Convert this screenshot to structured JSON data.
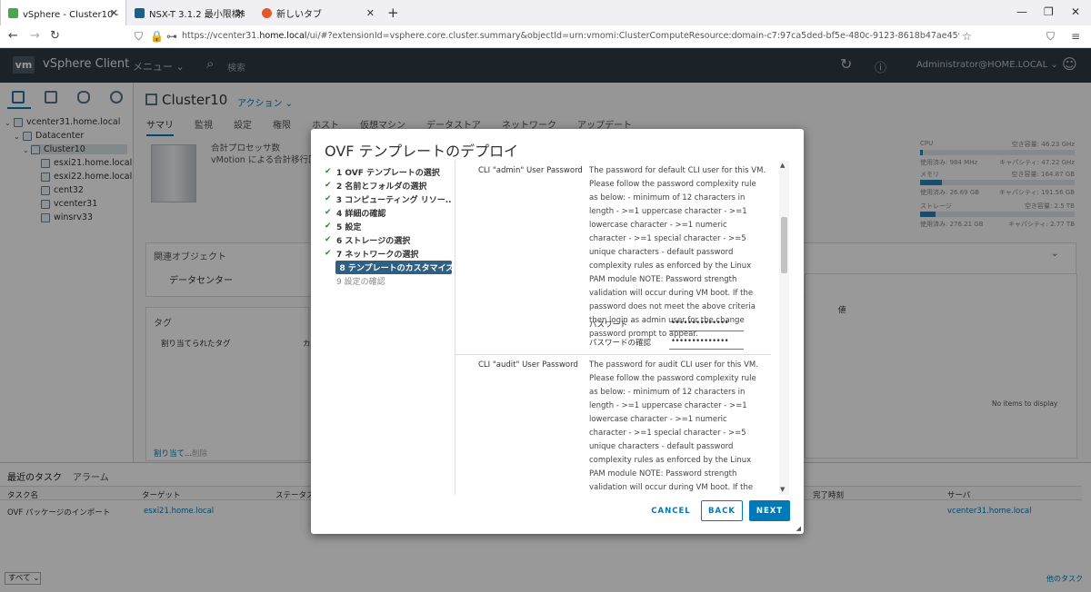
{
  "browser": {
    "tabs": [
      {
        "title": "vSphere - Cluster10 - サマリ",
        "fav_color": "#4aa64a"
      },
      {
        "title": "NSX-T 3.1.2 最小限構成のインスト",
        "fav_color": "#1d5f86"
      },
      {
        "title": "新しいタブ",
        "fav_color": "#e05a2b"
      }
    ],
    "url_prefix": "https://vcenter31.",
    "url_host": "home.local",
    "url_rest": "/ui/#?extensionId=vsphere.core.cluster.summary&objectId=urn:vmomi:ClusterComputeResource:domain-c7:97ca5ded-bf5e-480c-9123-8618b47ae459&navigator=vsphere.core.viTree.hostsAndClust"
  },
  "header": {
    "logo": "vm",
    "title": "vSphere Client",
    "menu": "メニュー",
    "search_placeholder": "検索",
    "user": "Administrator@HOME.LOCAL"
  },
  "tree": [
    {
      "label": "vcenter31.home.local"
    },
    {
      "label": "Datacenter"
    },
    {
      "label": "Cluster10"
    },
    {
      "label": "esxi21.home.local"
    },
    {
      "label": "esxi22.home.local"
    },
    {
      "label": "cent32"
    },
    {
      "label": "vcenter31"
    },
    {
      "label": "winsrv33"
    }
  ],
  "content": {
    "title": "Cluster10",
    "action": "アクション",
    "tabs": [
      "サマリ",
      "監視",
      "設定",
      "権限",
      "ホスト",
      "仮想マシン",
      "データストア",
      "ネットワーク",
      "アップデート"
    ],
    "stat1": "合計プロセッサ数",
    "stat2": "vMotion による合計移行回数",
    "related_title": "関連オブジェクト",
    "related_item": "データセンター",
    "tags_title": "タグ",
    "tags_col1": "割り当てられたタグ",
    "tags_col2": "カ",
    "assign": "割り当て...",
    "remove": "削除",
    "attr_col": "値",
    "no_items": "No items to display",
    "res": [
      {
        "name": "CPU",
        "free": "空き容量: 46.23 GHz",
        "used": "使用済み: 984 MHz",
        "cap": "キャパシティ: 47.22 GHz",
        "fill": 0.02
      },
      {
        "name": "メモリ",
        "free": "空き容量: 164.87 GB",
        "used": "使用済み: 26.69 GB",
        "cap": "キャパシティ: 191.56 GB",
        "fill": 0.14
      },
      {
        "name": "ストレージ",
        "free": "空き容量: 2.5 TB",
        "used": "使用済み: 276.21 GB",
        "cap": "キャパシティ: 2.77 TB",
        "fill": 0.1
      }
    ]
  },
  "tasks": {
    "tab_recent": "最近のタスク",
    "tab_alarm": "アラーム",
    "cols": [
      "タスク名",
      "ターゲット",
      "ステータス",
      "完了時刻",
      "サーバ"
    ],
    "row": {
      "name": "OVF パッケージのインポート",
      "target": "esxi21.home.local",
      "server": "vcenter31.home.local"
    },
    "filter": "すべて",
    "more": "他のタスク"
  },
  "modal": {
    "title": "OVF テンプレートのデプロイ",
    "steps": [
      {
        "label": "1 OVF テンプレートの選択",
        "state": "done"
      },
      {
        "label": "2 名前とフォルダの選択",
        "state": "done"
      },
      {
        "label": "3 コンピューティング リソー...",
        "state": "done"
      },
      {
        "label": "4 詳細の確認",
        "state": "done"
      },
      {
        "label": "5 設定",
        "state": "done"
      },
      {
        "label": "6 ストレージの選択",
        "state": "done"
      },
      {
        "label": "7 ネットワークの選択",
        "state": "done"
      },
      {
        "label": "8 テンプレートのカスタマイズ",
        "state": "current"
      },
      {
        "label": "9 設定の確認",
        "state": "pending"
      }
    ],
    "check_mark": "✔",
    "props": [
      {
        "label": "CLI \"admin\" User Password",
        "desc": "The password for default CLI user for this VM. Please follow the password complexity rule as below: - minimum of 12 characters in length - >=1 uppercase character - >=1 lowercase character - >=1 numeric character - >=1 special character - >=5 unique characters - default password complexity rules as enforced by the Linux PAM module NOTE: Password strength validation will occur during VM boot. If the password does not meet the above criteria then login as admin user for the change password prompt to appear.",
        "pw_label": "パスワード",
        "pw_value": "••••••••••••••",
        "confirm_label": "パスワードの確認",
        "confirm_value": "••••••••••••••"
      },
      {
        "label": "CLI \"audit\" User Password",
        "desc": "The password for audit CLI user for this VM. Please follow the password complexity rule as below: - minimum of 12 characters in length - >=1 uppercase character - >=1 lowercase character - >=1 numeric character - >=1 special character - >=5 unique characters - default password complexity rules as enforced by the Linux PAM module NOTE: Password strength validation will occur during VM boot. If the password does not meet the above criteria then login as admin user"
      }
    ],
    "buttons": {
      "cancel": "CANCEL",
      "back": "BACK",
      "next": "NEXT"
    }
  }
}
